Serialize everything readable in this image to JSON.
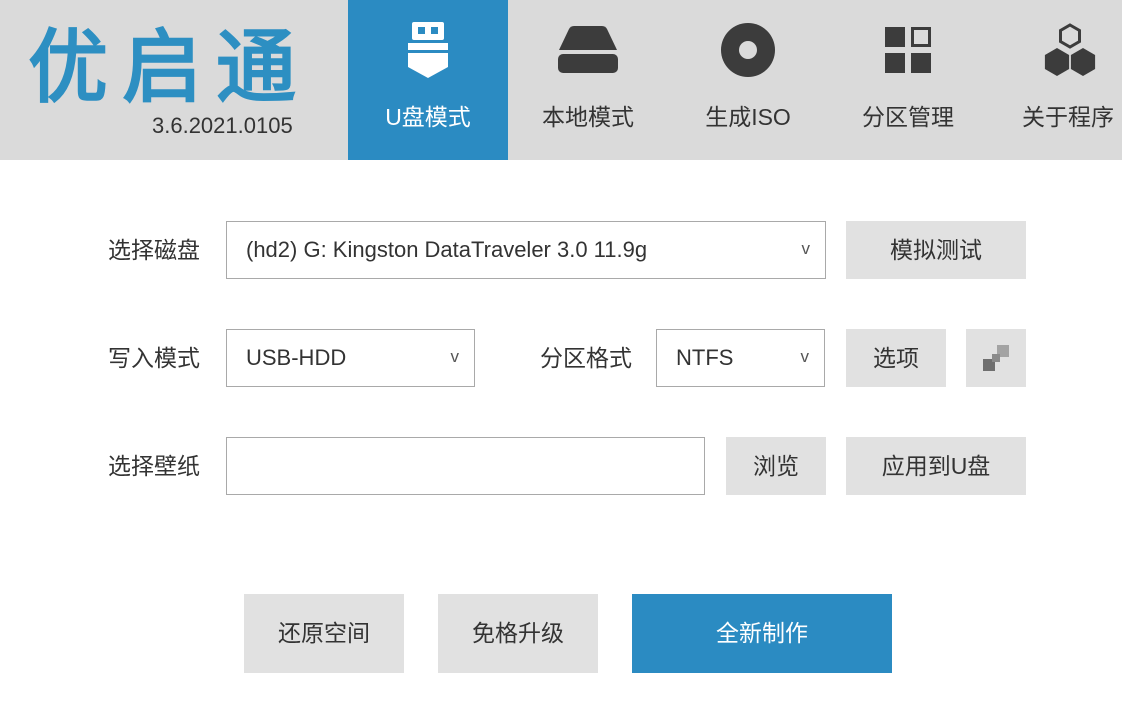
{
  "app": {
    "logo_text": "优启通",
    "version": "3.6.2021.0105"
  },
  "tabs": [
    {
      "label": "U盘模式",
      "icon": "usb-drive-icon",
      "active": true
    },
    {
      "label": "本地模式",
      "icon": "hard-disk-icon",
      "active": false
    },
    {
      "label": "生成ISO",
      "icon": "disc-icon",
      "active": false
    },
    {
      "label": "分区管理",
      "icon": "partition-grid-icon",
      "active": false
    },
    {
      "label": "关于程序",
      "icon": "hexagons-icon",
      "active": false
    }
  ],
  "form": {
    "dropdown_chevron": "v",
    "disk": {
      "label": "选择磁盘",
      "value": "(hd2) G: Kingston DataTraveler 3.0 11.9g"
    },
    "simulate_button": "模拟测试",
    "write_mode": {
      "label": "写入模式",
      "value": "USB-HDD"
    },
    "partition_format": {
      "label": "分区格式",
      "value": "NTFS"
    },
    "options_button": "选项",
    "extra_button_icon": "pixel-squares-icon",
    "wallpaper": {
      "label": "选择壁纸",
      "value": ""
    },
    "browse_button": "浏览",
    "apply_button": "应用到U盘"
  },
  "actions": {
    "restore_space": "还原空间",
    "format_free_upgrade": "免格升级",
    "fresh_create": "全新制作"
  },
  "colors": {
    "accent": "#2b8bc2",
    "logo": "#2d8fc2",
    "header_bg": "#dadada",
    "button_bg": "#e1e1e1",
    "icon": "#3c3c3c",
    "text": "#333333"
  }
}
